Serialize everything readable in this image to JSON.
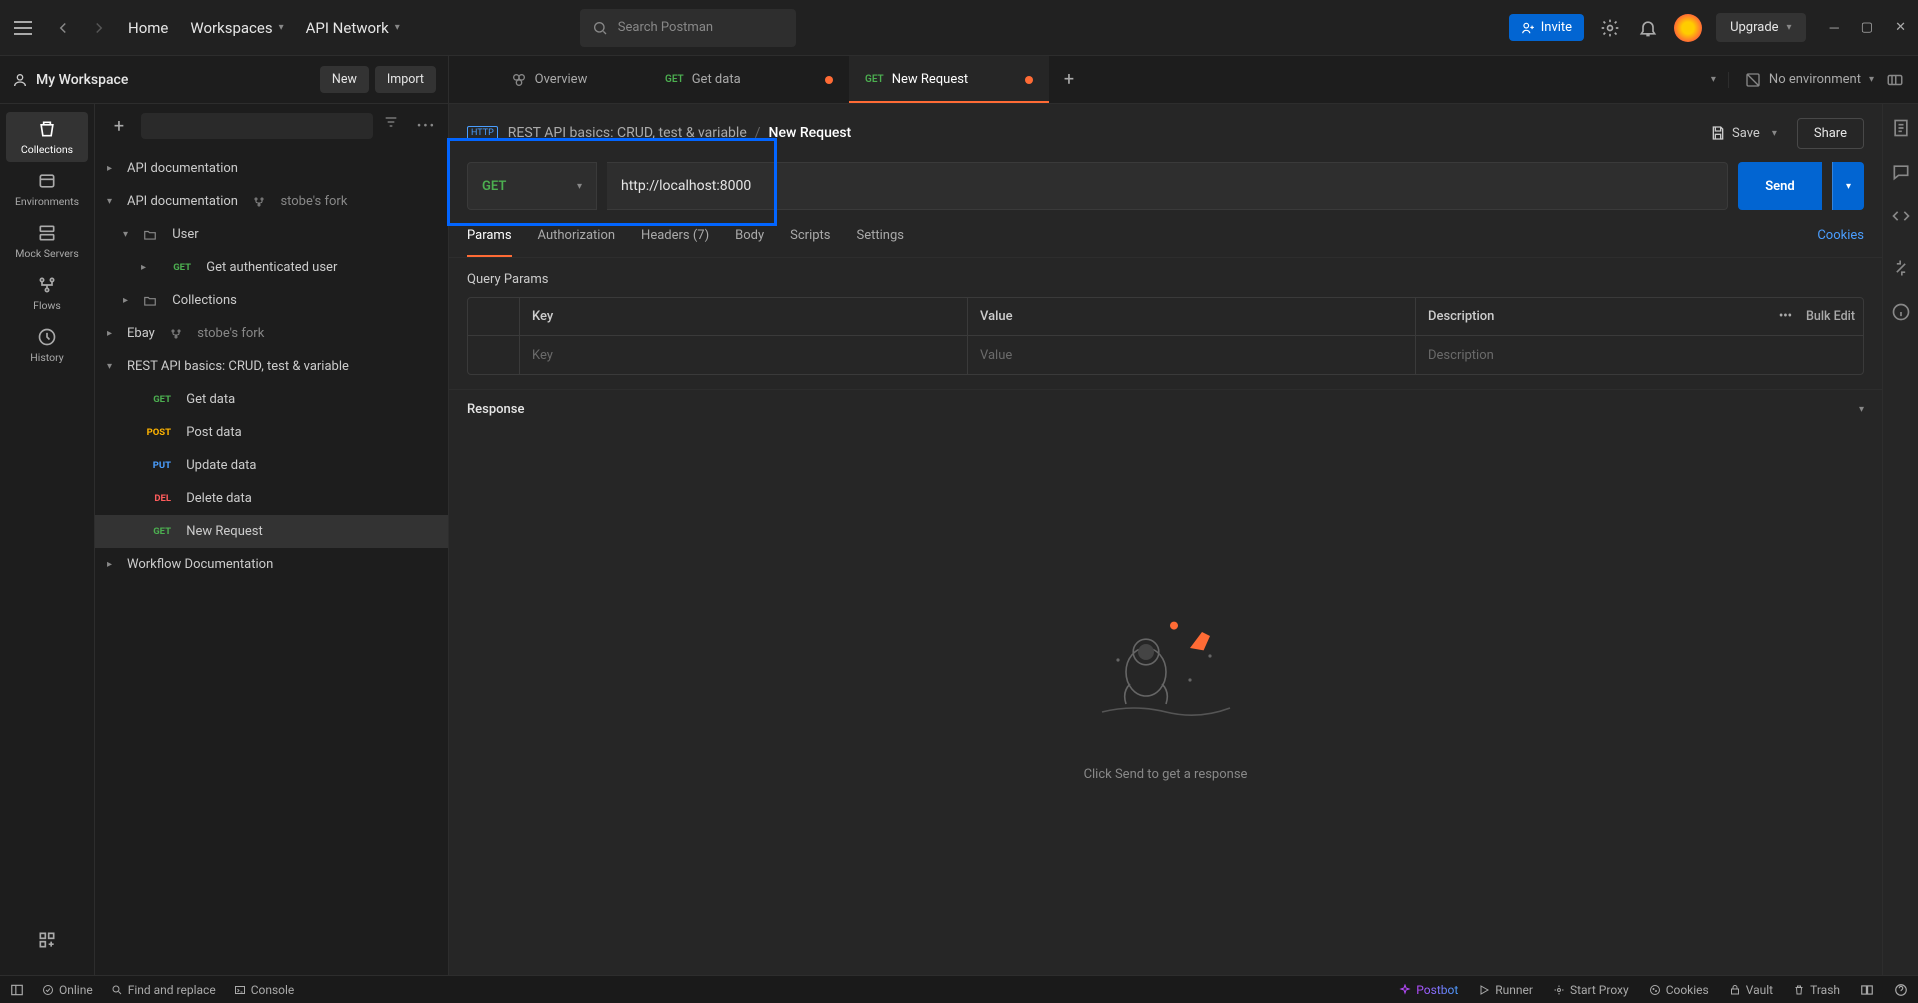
{
  "titlebar": {
    "nav": {
      "home": "Home",
      "workspaces": "Workspaces",
      "api_network": "API Network"
    },
    "search_placeholder": "Search Postman",
    "invite": "Invite",
    "upgrade": "Upgrade"
  },
  "workspace": {
    "name": "My Workspace",
    "new_btn": "New",
    "import_btn": "Import"
  },
  "tabs": {
    "overview": "Overview",
    "get_data": {
      "method": "GET",
      "label": "Get data"
    },
    "new_request": {
      "method": "GET",
      "label": "New Request"
    }
  },
  "environment": {
    "label": "No environment"
  },
  "side_rail": {
    "collections": "Collections",
    "environments": "Environments",
    "mock_servers": "Mock Servers",
    "flows": "Flows",
    "history": "History"
  },
  "tree": {
    "api_doc": "API documentation",
    "api_doc_fork": {
      "label": "API documentation",
      "fork": "stobe's fork"
    },
    "user": "User",
    "get_auth_user": {
      "method": "GET",
      "label": "Get authenticated user"
    },
    "collections": "Collections",
    "ebay": {
      "label": "Ebay",
      "fork": "stobe's fork"
    },
    "rest_basics": "REST API basics: CRUD, test & variable",
    "get_data": {
      "method": "GET",
      "label": "Get data"
    },
    "post_data": {
      "method": "POST",
      "label": "Post data"
    },
    "update_data": {
      "method": "PUT",
      "label": "Update data"
    },
    "delete_data": {
      "method": "DEL",
      "label": "Delete data"
    },
    "new_request": {
      "method": "GET",
      "label": "New Request"
    },
    "workflow_doc": "Workflow Documentation"
  },
  "editor": {
    "breadcrumb_parent": "REST API basics: CRUD, test & variable",
    "breadcrumb_current": "New Request",
    "save": "Save",
    "share": "Share",
    "method": "GET",
    "url": "http://localhost:8000",
    "send": "Send",
    "tabs": {
      "params": "Params",
      "authorization": "Authorization",
      "headers": "Headers (7)",
      "body": "Body",
      "scripts": "Scripts",
      "settings": "Settings",
      "cookies": "Cookies"
    },
    "params_title": "Query Params",
    "table": {
      "key": "Key",
      "value": "Value",
      "description": "Description",
      "key_ph": "Key",
      "value_ph": "Value",
      "desc_ph": "Description",
      "bulk_edit": "Bulk Edit"
    },
    "response_label": "Response",
    "response_hint": "Click Send to get a response"
  },
  "statusbar": {
    "online": "Online",
    "find_replace": "Find and replace",
    "console": "Console",
    "postbot": "Postbot",
    "runner": "Runner",
    "start_proxy": "Start Proxy",
    "cookies": "Cookies",
    "vault": "Vault",
    "trash": "Trash"
  }
}
